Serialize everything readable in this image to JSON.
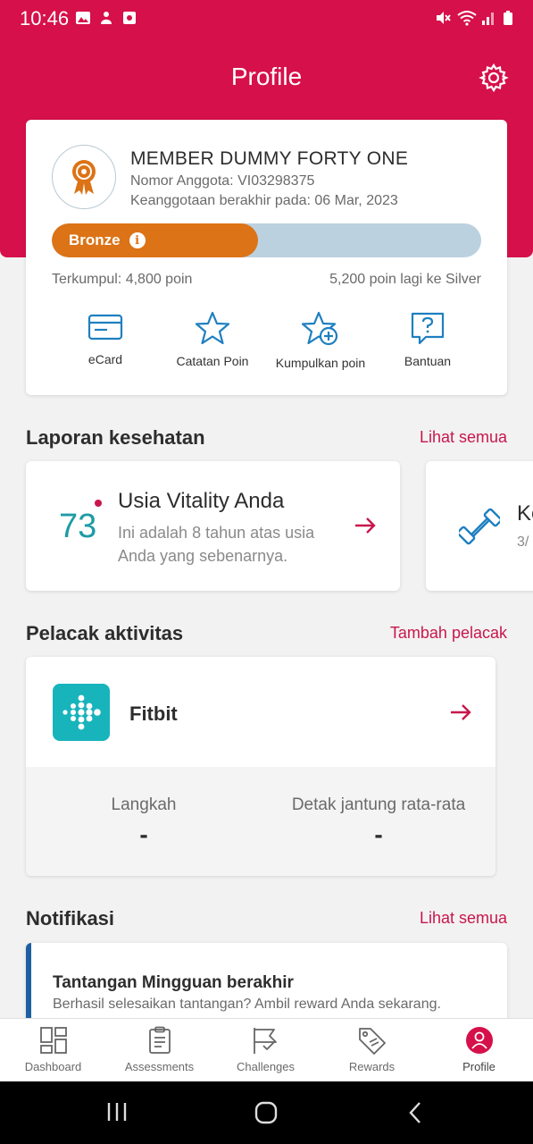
{
  "status_bar": {
    "time": "10:46"
  },
  "header": {
    "title": "Profile"
  },
  "member": {
    "name": "MEMBER DUMMY FORTY ONE",
    "member_number": "Nomor Anggota: VI03298375",
    "expiry": "Keanggotaan berakhir pada: 06 Mar, 2023",
    "tier": "Bronze",
    "tier_progress_fraction": 0.48,
    "collected": "Terkumpul: 4,800 poin",
    "to_next": "5,200 poin lagi ke Silver",
    "actions": [
      {
        "label": "eCard",
        "icon": "ecard-icon"
      },
      {
        "label": "Catatan Poin",
        "icon": "star-icon"
      },
      {
        "label": "Kumpulkan poin",
        "icon": "star-plus-icon"
      },
      {
        "label": "Bantuan",
        "icon": "help-icon"
      }
    ]
  },
  "health": {
    "title": "Laporan kesehatan",
    "see_all": "Lihat semua",
    "cards": [
      {
        "score": "73",
        "title": "Usia Vitality Anda",
        "desc": "Ini adalah 8 tahun atas usia Anda yang sebenarnya."
      },
      {
        "title": "Ke",
        "sub": "3/"
      }
    ]
  },
  "trackers": {
    "title": "Pelacak aktivitas",
    "add": "Tambah pelacak",
    "device": "Fitbit",
    "steps_label": "Langkah",
    "steps_value": "-",
    "hr_label": "Detak jantung rata-rata",
    "hr_value": "-"
  },
  "notifications": {
    "title": "Notifikasi",
    "see_all": "Lihat semua",
    "items": [
      {
        "title": "Tantangan Mingguan berakhir",
        "desc": "Berhasil selesaikan tantangan? Ambil reward Anda sekarang."
      }
    ]
  },
  "tabs": [
    {
      "label": "Dashboard",
      "icon": "dashboard-icon"
    },
    {
      "label": "Assessments",
      "icon": "clipboard-icon"
    },
    {
      "label": "Challenges",
      "icon": "flag-icon"
    },
    {
      "label": "Rewards",
      "icon": "tag-icon"
    },
    {
      "label": "Profile",
      "icon": "profile-icon",
      "active": true
    }
  ],
  "colors": {
    "brand": "#d6104a",
    "accent_link": "#c8174d",
    "bronze": "#dc7316",
    "teal": "#1f9ba5"
  }
}
